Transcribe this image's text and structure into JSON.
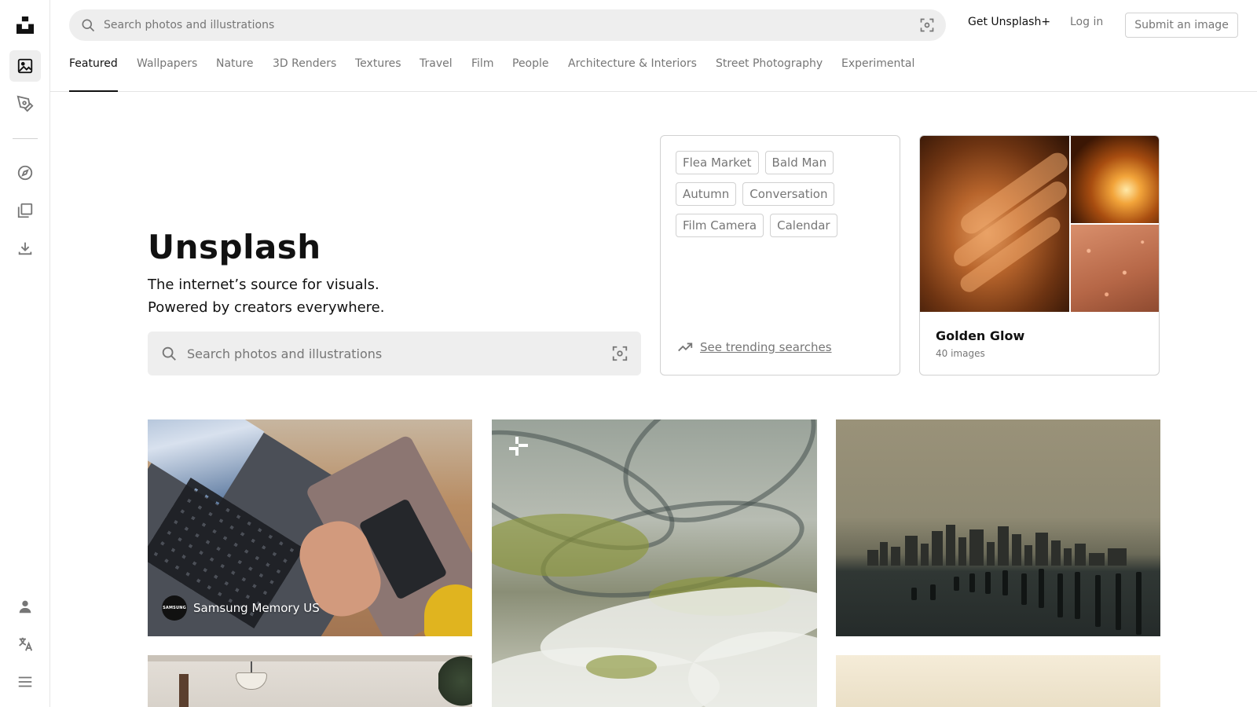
{
  "header": {
    "search_placeholder": "Search photos and illustrations",
    "get_plus": "Get Unsplash+",
    "login": "Log in",
    "submit": "Submit an image"
  },
  "sidebar": {
    "items": [
      {
        "icon": "unsplash-logo-icon"
      },
      {
        "icon": "photos-icon",
        "active": true
      },
      {
        "icon": "illustrations-icon"
      },
      {
        "icon": "explore-icon"
      },
      {
        "icon": "collections-icon"
      },
      {
        "icon": "download-icon"
      },
      {
        "icon": "user-icon"
      },
      {
        "icon": "language-icon"
      },
      {
        "icon": "menu-icon"
      }
    ]
  },
  "tabs": [
    {
      "label": "Featured",
      "active": true
    },
    {
      "label": "Wallpapers"
    },
    {
      "label": "Nature"
    },
    {
      "label": "3D Renders"
    },
    {
      "label": "Textures"
    },
    {
      "label": "Travel"
    },
    {
      "label": "Film"
    },
    {
      "label": "People"
    },
    {
      "label": "Architecture & Interiors"
    },
    {
      "label": "Street Photography"
    },
    {
      "label": "Experimental"
    }
  ],
  "hero": {
    "title": "Unsplash",
    "subtitle_line1": "The internet’s source for visuals.",
    "subtitle_line2": "Powered by creators everywhere.",
    "search_placeholder": "Search photos and illustrations"
  },
  "trending": {
    "chips": [
      "Flea Market",
      "Bald Man",
      "Autumn",
      "Conversation",
      "Film Camera",
      "Calendar"
    ],
    "link": "See trending searches"
  },
  "collection": {
    "title": "Golden Glow",
    "count": "40 images"
  },
  "photos": [
    {
      "author": "Samsung Memory US",
      "avatar_text": "SAMSUNG"
    },
    {
      "badge": "unsplash-plus-icon"
    },
    {}
  ],
  "colors": {
    "text": "#111111",
    "muted": "#767676",
    "border": "#d1d1d1",
    "search_bg": "#eeeeee"
  }
}
